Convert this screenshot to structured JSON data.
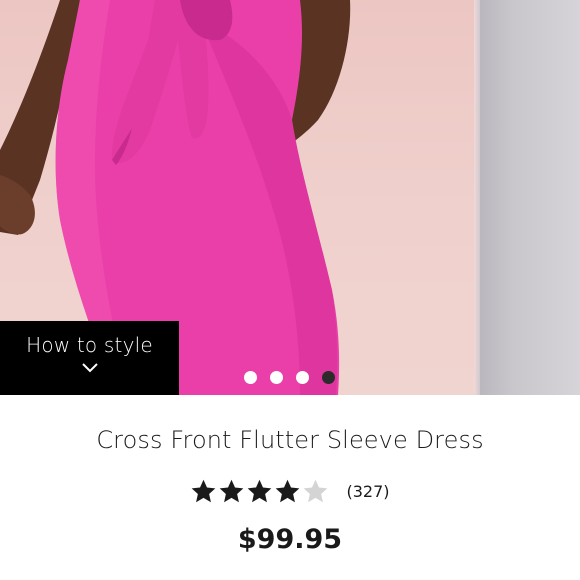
{
  "product": {
    "title": "Cross Front Flutter Sleeve Dress",
    "price": "$99.95",
    "rating": 4,
    "rating_max": 5,
    "review_count": "(327)"
  },
  "image": {
    "how_to_style_label": "How to style",
    "carousel_total": 4,
    "carousel_active_index": 4
  },
  "colors": {
    "dress": "#ea3fa8",
    "star_filled": "#1a1a1a",
    "star_empty": "#d4d4d4",
    "overlay": "#000000"
  },
  "icons": {
    "chevron": "chevron-down-icon",
    "star": "star-icon"
  }
}
